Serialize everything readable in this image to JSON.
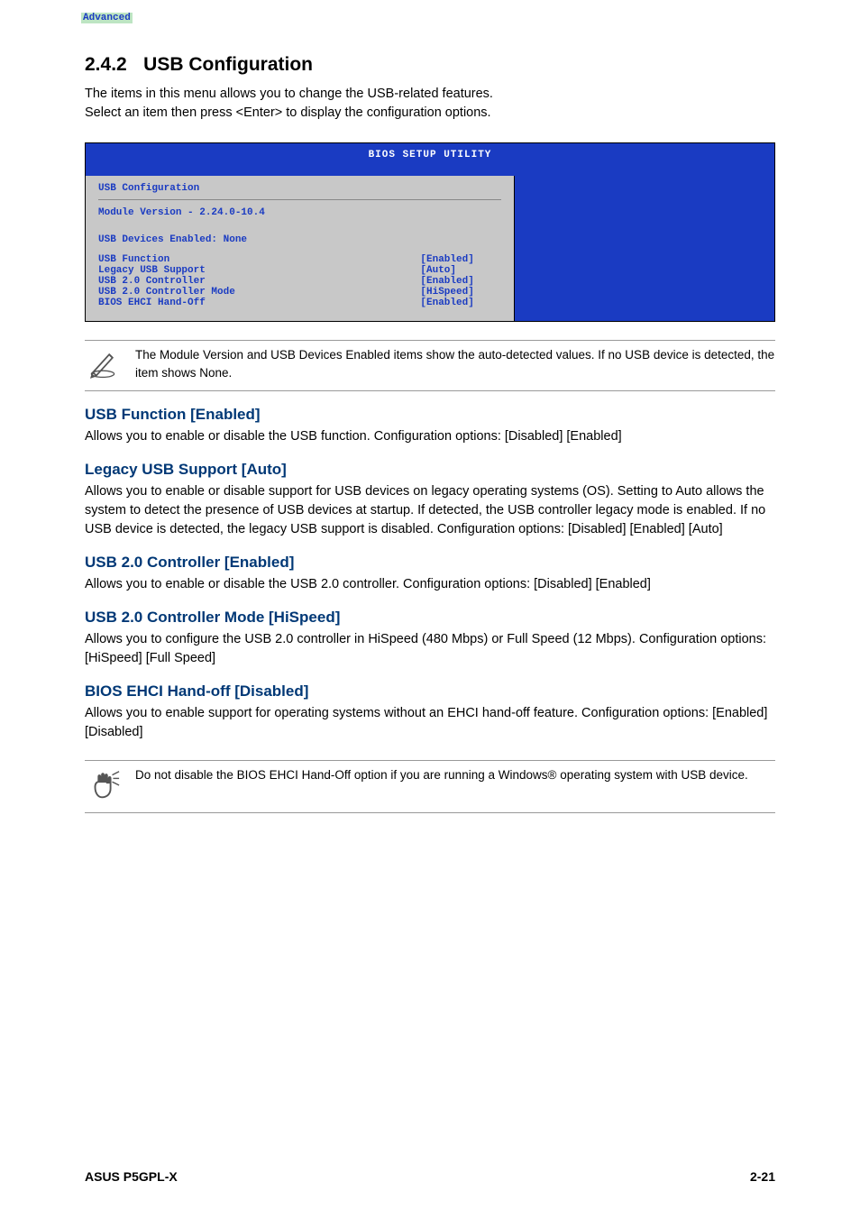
{
  "section": {
    "number": "2.4.2",
    "title": "USB Configuration",
    "intro1": "The items in this menu allows you to change the USB-related features.",
    "intro2": "Select an item then press <Enter> to display the configuration options."
  },
  "bios": {
    "headerTitle": "BIOS SETUP UTILITY",
    "tab": "Advanced",
    "panelTitle": "USB Configuration",
    "moduleVersion": "Module Version - 2.24.0-10.4",
    "devicesEnabled": "USB Devices Enabled: None",
    "items": [
      {
        "label": "USB Function",
        "value": "[Enabled]"
      },
      {
        "label": "Legacy USB Support",
        "value": "[Auto]"
      },
      {
        "label": "USB 2.0 Controller",
        "value": "[Enabled]"
      },
      {
        "label": "USB 2.0 Controller Mode",
        "value": "[HiSpeed]"
      },
      {
        "label": "BIOS EHCI Hand-Off",
        "value": "[Enabled]"
      }
    ]
  },
  "noteModule": "The Module Version and USB Devices Enabled items show the auto-detected values. If no USB device is detected, the item shows None.",
  "settings": [
    {
      "heading": "USB Function [Enabled]",
      "text": "Allows you to enable or disable the USB function. Configuration options: [Disabled] [Enabled]"
    },
    {
      "heading": "Legacy USB Support [Auto]",
      "text": "Allows you to enable or disable support for USB devices on legacy operating systems (OS). Setting to Auto allows the system to detect the presence of USB devices at startup. If detected, the USB controller legacy mode is enabled. If no USB device is detected, the legacy USB support is disabled. Configuration options: [Disabled] [Enabled] [Auto]"
    },
    {
      "heading": "USB 2.0 Controller [Enabled]",
      "text": "Allows you to enable or disable the USB 2.0 controller. Configuration options: [Disabled] [Enabled]"
    },
    {
      "heading": "USB 2.0 Controller Mode [HiSpeed]",
      "text": "Allows you to configure the USB 2.0 controller in HiSpeed (480 Mbps) or Full Speed (12 Mbps). Configuration options: [HiSpeed] [Full Speed]"
    },
    {
      "heading": "BIOS EHCI Hand-off [Disabled]",
      "text": "Allows you to enable support for operating systems without an EHCI hand-off feature. Configuration options: [Enabled] [Disabled]"
    }
  ],
  "noteEhci": "Do not disable the BIOS EHCI Hand-Off option if you are running a Windows® operating system with USB device.",
  "footer": {
    "left": "ASUS P5GPL-X",
    "right": "2-21"
  }
}
